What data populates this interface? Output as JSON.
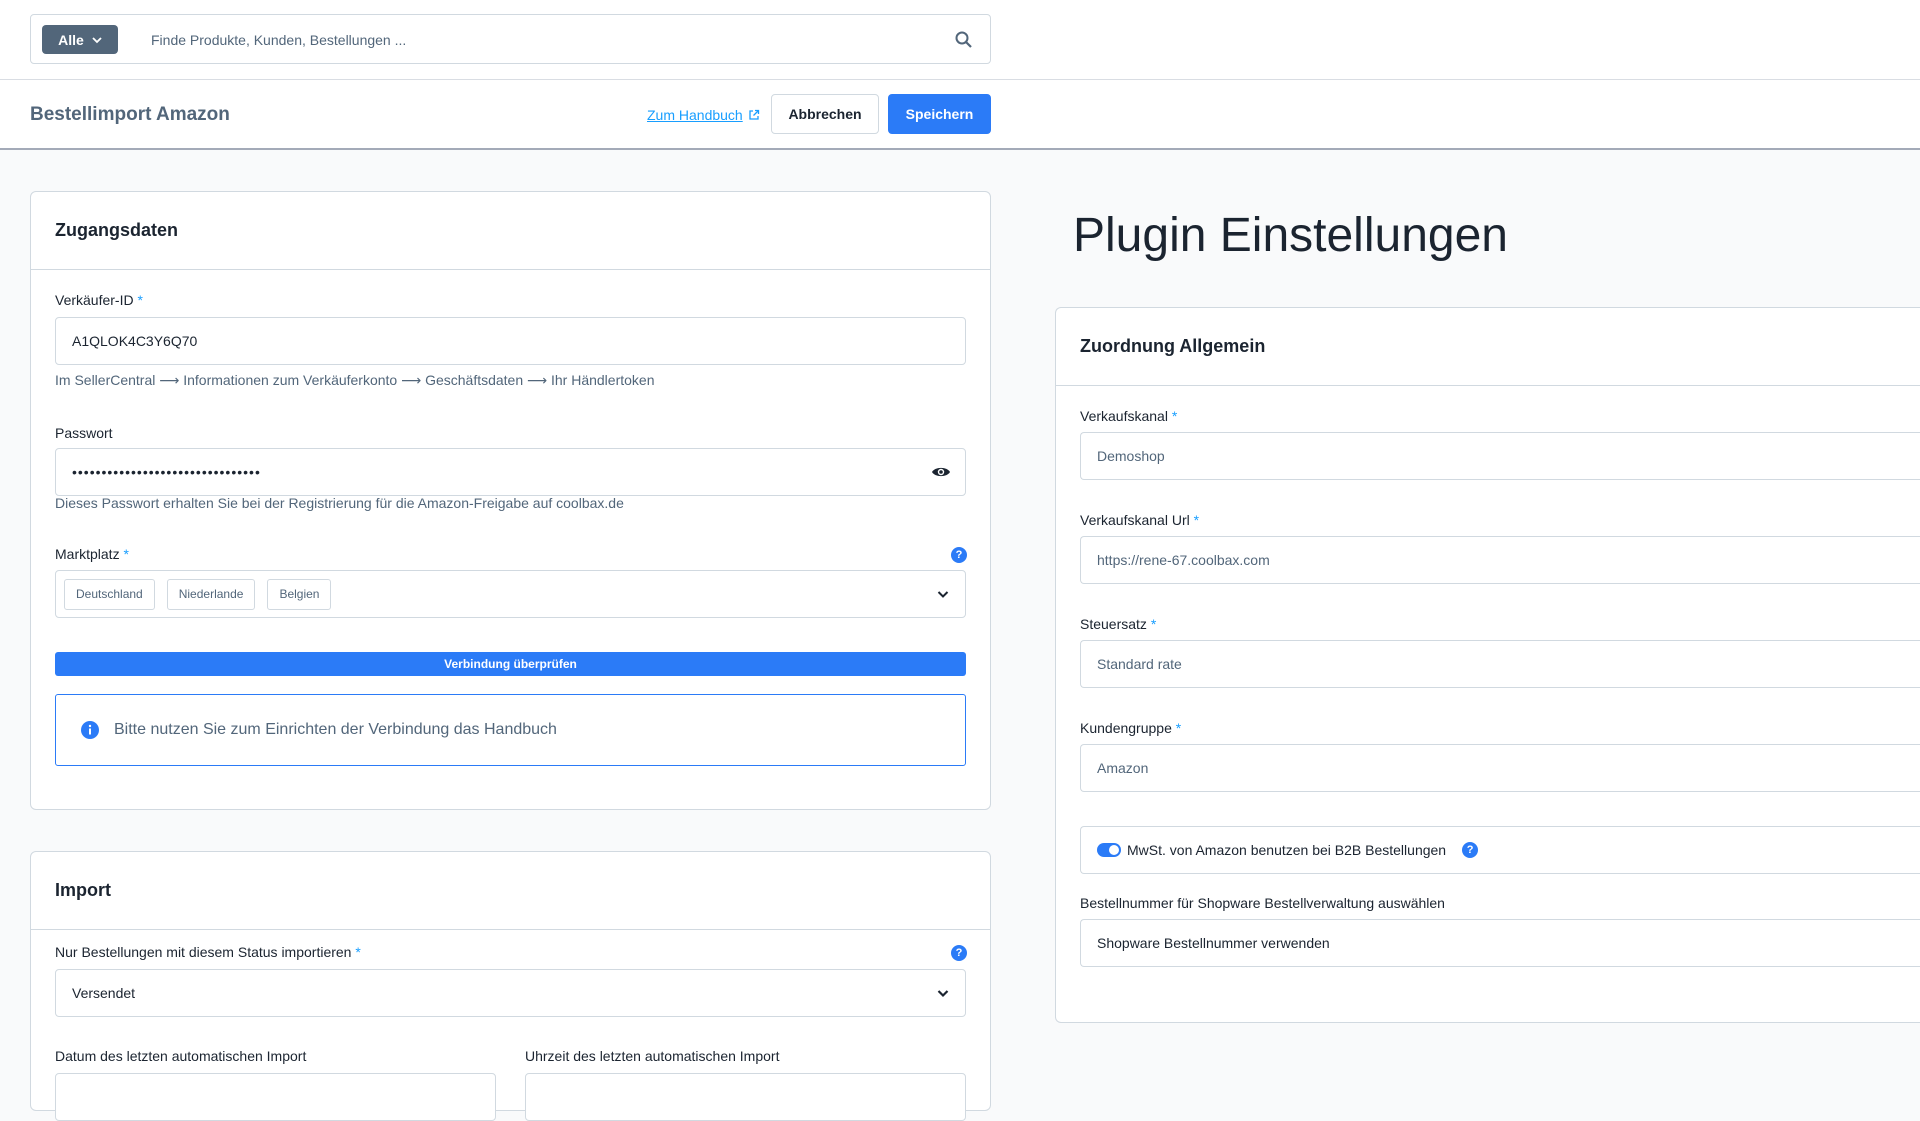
{
  "search": {
    "scope_label": "Alle",
    "placeholder": "Finde Produkte, Kunden, Bestellungen ..."
  },
  "header": {
    "title": "Bestellimport Amazon",
    "manual_link": "Zum Handbuch",
    "cancel_label": "Abbrechen",
    "save_label": "Speichern"
  },
  "credentials": {
    "title": "Zugangsdaten",
    "seller_id_label": "Verkäufer-ID",
    "seller_id_value": "A1QLOK4C3Y6Q70",
    "seller_id_hint": "Im SellerCentral ⟶ Informationen zum Verkäuferkonto ⟶ Geschäftsdaten ⟶ Ihr Händlertoken",
    "password_label": "Passwort",
    "password_value": "••••••••••••••••••••••••••••••••",
    "password_hint": "Dieses Passwort erhalten Sie bei der Registrierung für die Amazon-Freigabe auf coolbax.de",
    "marketplace_label": "Marktplatz",
    "marketplaces": [
      "Deutschland",
      "Niederlande",
      "Belgien"
    ],
    "verify_label": "Verbindung überprüfen",
    "info_text": "Bitte nutzen Sie zum Einrichten der Verbindung das Handbuch"
  },
  "import": {
    "title": "Import",
    "status_label": "Nur Bestellungen mit diesem Status importieren",
    "status_value": "Versendet",
    "last_date_label": "Datum des letzten automatischen Import",
    "last_time_label": "Uhrzeit des letzten automatischen Import"
  },
  "plugin": {
    "title": "Plugin Einstellungen",
    "card_title": "Zuordnung Allgemein",
    "channel_label": "Verkaufskanal",
    "channel_value": "Demoshop",
    "channel_url_label": "Verkaufskanal Url",
    "channel_url_value": "https://rene-67.coolbax.com",
    "tax_label": "Steuersatz",
    "tax_value": "Standard rate",
    "customer_group_label": "Kundengruppe",
    "customer_group_value": "Amazon",
    "vat_toggle_label": "MwSt. von Amazon benutzen bei B2B Bestellungen",
    "vat_toggle_on": true,
    "order_number_label": "Bestellnummer für Shopware Bestellverwaltung auswählen",
    "order_number_value": "Shopware Bestellnummer verwenden"
  },
  "required_marker": "*",
  "help_glyph": "?",
  "colors": {
    "primary": "#2b7bf7",
    "link": "#189eff",
    "muted": "#52667a",
    "border": "#d1d9e0"
  }
}
